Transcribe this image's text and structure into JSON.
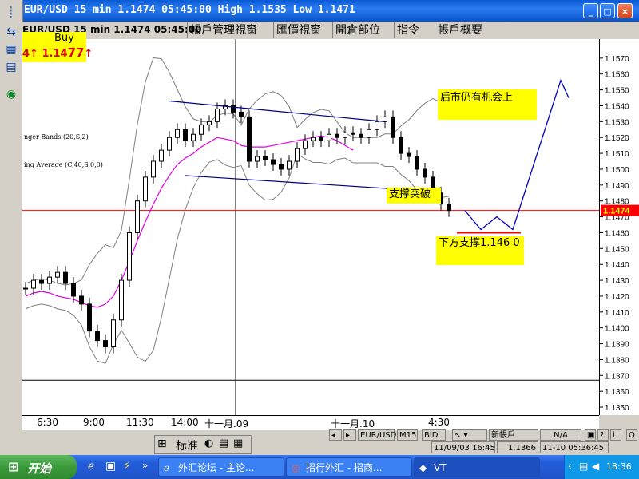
{
  "window": {
    "title": "EUR/USD 15 min 1.1474 05:45:00 High 1.1535 Low 1.1471",
    "buttons": [
      "_",
      "□",
      "×"
    ]
  },
  "chart_header": "EUR/USD 15 min 1.1474 05:45:00",
  "tabs": [
    "帳戶管理視窗",
    "匯價視窗",
    "開倉部位",
    "指令",
    "帳戶概要"
  ],
  "buy": {
    "label": "Buy",
    "left_value": "4",
    "value_prefix": "1.14",
    "value_big": "77",
    "arrow": "↑",
    "left_arrow": "↑"
  },
  "indicators": [
    "nger Bands (20,S,2)",
    "ing Average (C,40,S,0,0)"
  ],
  "notes": {
    "top": "后市仍有机会上",
    "middle": "支撑突破",
    "bottom": "下方支撑1.146 0"
  },
  "colors": {
    "price_line": "#ff0000",
    "ma": "#e000e0",
    "bands": "#808080",
    "trend": "#000080",
    "note_bg": "#ffff00",
    "candle": "#000000"
  },
  "chart_data": {
    "type": "line",
    "title": "EUR/USD 15 min",
    "xlabel": "",
    "ylabel": "",
    "ylim": [
      1.1345,
      1.1582
    ],
    "y_ticks": [
      "1.1570",
      "1.1560",
      "1.1550",
      "1.1540",
      "1.1530",
      "1.1520",
      "1.1510",
      "1.1500",
      "1.1490",
      "1.1480",
      "1.1470",
      "1.1460",
      "1.1450",
      "1.1440",
      "1.1430",
      "1.1420",
      "1.1410",
      "1.1400",
      "1.1390",
      "1.1380",
      "1.1370",
      "1.1360",
      "1.1350"
    ],
    "x_ticks": [
      "6:30",
      "9:00",
      "11:30",
      "14:00",
      "十一月.09",
      "十一月.10",
      "4:30"
    ],
    "current_price": "1.1474",
    "horizontal_lines": [
      1.1474,
      1.1367
    ],
    "support_level": 1.146,
    "series": [
      {
        "values": [
          1.1425,
          1.143,
          1.1428,
          1.1432,
          1.1435,
          1.1428,
          1.142,
          1.1415,
          1.1398,
          1.1392,
          1.1388,
          1.1405,
          1.143,
          1.146,
          1.148,
          1.1495,
          1.1505,
          1.1512,
          1.152,
          1.1525,
          1.1518,
          1.1522,
          1.1528,
          1.153,
          1.1538,
          1.154,
          1.1536,
          1.1533,
          1.1505,
          1.1508,
          1.1506,
          1.1503,
          1.15,
          1.1505,
          1.1513,
          1.1518,
          1.152,
          1.1518,
          1.1522,
          1.152,
          1.1523,
          1.1522,
          1.152,
          1.1525,
          1.153,
          1.1533,
          1.152,
          1.151,
          1.1508,
          1.15,
          1.1495,
          1.1485,
          1.1478,
          1.1474
        ]
      },
      {
        "values": [
          1.142,
          1.1422,
          1.1423,
          1.1422,
          1.142,
          1.1419,
          1.1418,
          1.1416,
          1.1414,
          1.1413,
          1.1415,
          1.142,
          1.143,
          1.1442,
          1.1455,
          1.1467,
          1.1478,
          1.1488,
          1.1496,
          1.1503,
          1.1507,
          1.151,
          1.1514,
          1.1517,
          1.152,
          1.1519,
          1.1518,
          1.1515,
          1.1514,
          1.1514,
          1.1514,
          1.1515,
          1.1516,
          1.1517,
          1.1518,
          1.1519,
          1.152,
          1.1521,
          1.152,
          1.1518,
          1.1515,
          1.1512
        ]
      }
    ],
    "trend_lines": [
      {
        "x1": 18,
        "y1": 1.1543,
        "x2": 45,
        "y2": 1.153
      },
      {
        "x1": 20,
        "y1": 1.1496,
        "x2": 48,
        "y2": 1.1487
      }
    ],
    "projection": [
      1.1474,
      1.1462,
      1.147,
      1.1462,
      1.1556,
      1.1545
    ]
  },
  "status": {
    "standard_label": "标准",
    "symbol": "EUR/USD",
    "timeframe": "M15",
    "side": "BID",
    "new_account": "新帳戶",
    "na": "N/A",
    "q": "Q",
    "date_price": "11/09/03 16:45",
    "price": "1.1366",
    "date_time": "11-10 05:36:45"
  },
  "taskbar": {
    "start": "开始",
    "items": [
      "外汇论坛 - 主论...",
      "招行外汇 - 招商...",
      "VT"
    ],
    "clock": "18:36"
  }
}
